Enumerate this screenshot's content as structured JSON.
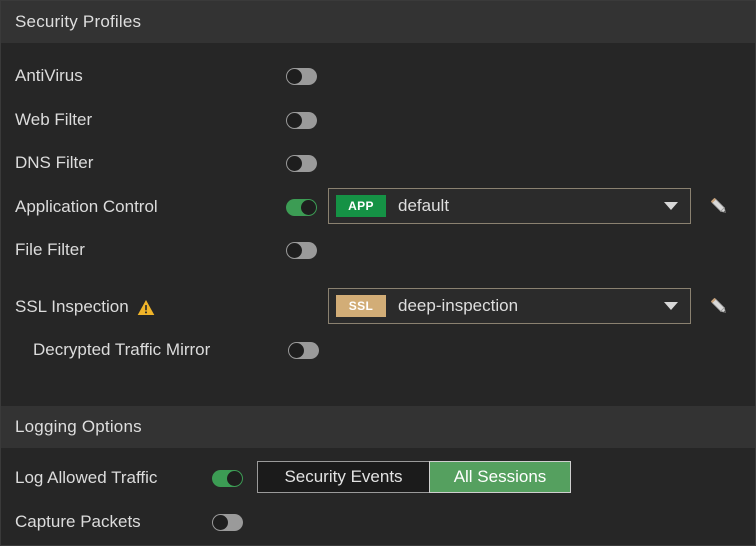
{
  "sections": {
    "security": {
      "title": "Security Profiles",
      "rows": [
        {
          "label": "AntiVirus",
          "toggle": "off"
        },
        {
          "label": "Web Filter",
          "toggle": "off"
        },
        {
          "label": "DNS Filter",
          "toggle": "off"
        },
        {
          "label": "Application Control",
          "toggle": "on"
        },
        {
          "label": "File Filter",
          "toggle": "off"
        },
        {
          "label": "SSL Inspection",
          "toggle": "warning"
        },
        {
          "label": "Decrypted Traffic Mirror",
          "toggle": "off"
        }
      ],
      "app_control": {
        "badge": "APP",
        "badge_color": "#159245",
        "value": "default",
        "caret_icon": "chevron-down-icon",
        "edit_icon": "pencil-icon"
      },
      "ssl_inspection": {
        "badge": "SSL",
        "badge_color": "#d2ad77",
        "value": "deep-inspection",
        "caret_icon": "chevron-down-icon",
        "edit_icon": "pencil-icon",
        "warning_icon": "warning-triangle-icon",
        "warning_color": "#f0b429"
      }
    },
    "logging": {
      "title": "Logging Options",
      "rows": [
        {
          "label": "Log Allowed Traffic",
          "toggle": "on"
        },
        {
          "label": "Capture Packets",
          "toggle": "off"
        }
      ],
      "log_mode": {
        "options": [
          "Security Events",
          "All Sessions"
        ],
        "selected": "All Sessions"
      }
    }
  },
  "colors": {
    "background": "#262626",
    "header_band": "#333333",
    "text": "#dcdcdc",
    "toggle_on": "#3c9c54",
    "toggle_off": "#9a9a9a",
    "segment_selected": "#55a05f"
  }
}
